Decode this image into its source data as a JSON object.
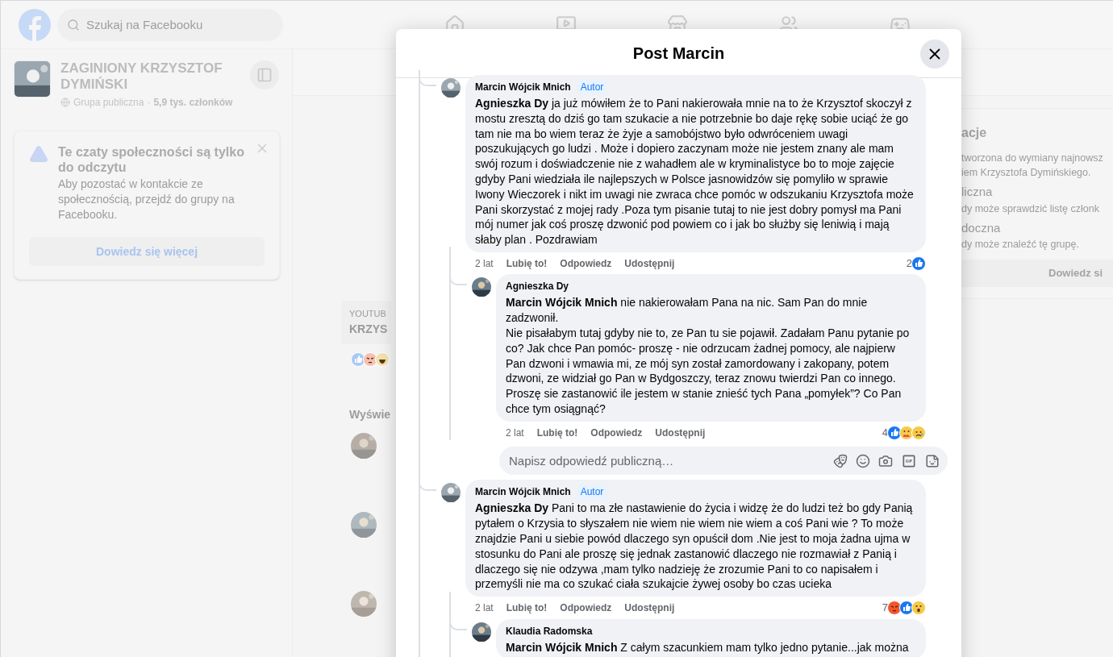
{
  "top_bar": {
    "search": {
      "placeholder": "Szukaj na Facebooku"
    }
  },
  "group": {
    "title": "ZAGINIONY KRZYSZTOF DYMIŃSKI",
    "privacy": "Grupa publiczna",
    "separator": "·",
    "members": "5,9 tys. członków"
  },
  "notice": {
    "title": "Te czaty społeczności są tylko do odczytu",
    "body": "Aby pozostać w kontakcie ze społecznością, przejdź do grupy na Facebooku.",
    "button": "Dowiedz się więcej"
  },
  "feed_post": {
    "source": "YOUTUB",
    "title": "KRZYS",
    "reactions": [
      {
        "kind": "like"
      },
      {
        "kind": "angry"
      },
      {
        "kind": "haha"
      }
    ],
    "section": "Wyświe"
  },
  "about": {
    "title": "acje",
    "lines": [
      "tworzona do wymiany najnowsz",
      "iem Krzysztofa Dymińskiego.",
      "liczna",
      "dy może sprawdzić listę członk",
      "doczna",
      "dy może znaleźć tę grupę."
    ],
    "button": "Dowiedz si"
  },
  "modal": {
    "title": "Post Marcin",
    "comments": [
      {
        "author": "Marcin Wójcik Mnich",
        "badge": "Autor",
        "text": "**Agnieszka Dy** ja już mówiłem że to Pani nakierowała mnie na to że Krzysztof skoczył z mostu zresztą do dziś go tam szukacie a nie potrzebnie bo daje rękę sobie uciąć że go tam nie ma bo wiem teraz że żyje a samobójstwo było odwróceniem uwagi poszukujących go ludzi . Może i dopiero zaczynam może nie jestem znany ale mam swój rozum i doświadczenie nie z wahadłem ale w kryminalistyce bo to moje zajęcie gdyby Pani wiedziała ile najlepszych w Polsce jasnowidzów się pomyliło w sprawie Iwony Wieczorek i nikt im uwagi nie zwraca chce pomóc w odszukaniu Krzysztofa może Pani skorzystać z mojej rady .Poza tym pisanie tutaj to nie jest dobry pomysł ma Pani mój numer jak coś proszę dzwonić pod powiem co i jak bo służby się leniwią i mają słaby plan . Pozdrawiam",
        "time": "2 lat",
        "actions": [
          "Lubię to!",
          "Odpowiedz",
          "Udostępnij"
        ],
        "reaction_count": "2",
        "reactions": [
          {
            "kind": "like"
          }
        ],
        "replies": [
          {
            "author": "Agnieszka Dy",
            "text": "**Marcin Wójcik Mnich** nie nakierowałam Pana na nic. Sam Pan do mnie zadzwonił.\nNie pisałabym tutaj gdyby nie to, ze Pan tu sie pojawił. Zadałam Panu pytanie po co? Jak chce Pan pomóc- proszę - nie odrzucam żadnej pomocy, ale najpierw Pan dzwoni i wmawia mi, ze mój syn został zamordowany i zakopany, potem dzwoni, ze widział go Pan w Bydgoszczy, teraz znowu twierdzi Pan co innego. Proszę sie zastanowić ile jestem w stanie znieść tych Pana „pomyłek”? Co Pan chce tym osiągnąć?",
            "time": "2 lat",
            "actions": [
              "Lubię to!",
              "Odpowiedz",
              "Udostępnij"
            ],
            "reaction_count": "4",
            "reactions": [
              {
                "kind": "like"
              },
              {
                "kind": "care"
              },
              {
                "kind": "sad"
              }
            ]
          }
        ],
        "reply_box": {
          "placeholder": "Napisz odpowiedź publiczną…"
        }
      },
      {
        "author": "Marcin Wójcik Mnich",
        "badge": "Autor",
        "text": "**Agnieszka Dy** Pani to ma złe nastawienie do życia i widzę że do ludzi też bo gdy Panią pytałem o Krzysia to słyszałem nie wiem nie wiem nie wiem a coś Pani wie ? To może znajdzie Pani u siebie powód dlaczego syn opuścił dom .Nie jest to moja żadna ujma w stosunku do Pani ale proszę się jednak zastanowić dlaczego nie rozmawiał z Panią i dlaczego się nie odzywa ,mam tylko nadzieję że zrozumie Pani to co napisałem i przemyśli nie ma co szukać ciała szukajcie żywej osoby bo czas ucieka",
        "time": "2 lat",
        "actions": [
          "Lubię to!",
          "Odpowiedz",
          "Udostępnij"
        ],
        "reaction_count": "7",
        "reactions": [
          {
            "kind": "angry"
          },
          {
            "kind": "like"
          },
          {
            "kind": "wow"
          }
        ],
        "replies": [
          {
            "author": "Klaudia Radomska",
            "text": "**Marcin Wójcik Mnich** Z całym szacunkiem mam tylko jedno pytanie...jak można"
          }
        ]
      }
    ]
  }
}
